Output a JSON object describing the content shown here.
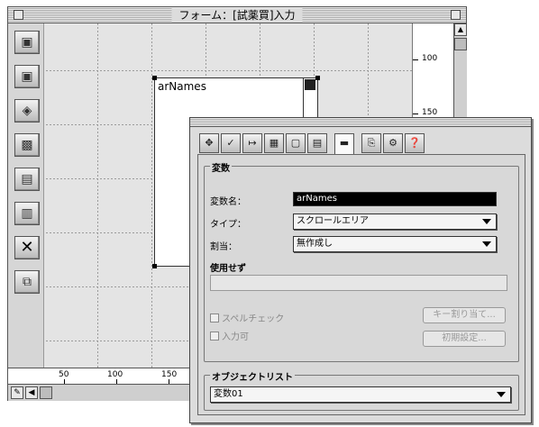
{
  "form_window": {
    "title": "フォーム：[試薬買]入力",
    "list_object_label": "arNames",
    "v_ruler_labels": [
      "100",
      "150"
    ],
    "h_ruler_labels": [
      "50",
      "100",
      "150"
    ],
    "tools": [
      {
        "icon": "field-icon"
      },
      {
        "icon": "field-icon"
      },
      {
        "icon": "button-icon"
      },
      {
        "icon": "database-icon"
      },
      {
        "icon": "document-icon"
      },
      {
        "icon": "document-icon"
      },
      {
        "icon": "delete-x-icon"
      },
      {
        "icon": "copy-icon"
      }
    ]
  },
  "property_window": {
    "tabs": [
      {
        "glyph": "✥",
        "icon": "move-icon"
      },
      {
        "glyph": "✓",
        "icon": "check-icon"
      },
      {
        "glyph": "↦",
        "icon": "arrow-icon"
      },
      {
        "glyph": "▦",
        "icon": "grid-icon"
      },
      {
        "glyph": "▢",
        "icon": "frame-icon"
      },
      {
        "glyph": "▤",
        "icon": "list-icon"
      },
      {
        "glyph": "▬",
        "icon": "field-icon"
      },
      {
        "glyph": "⎘",
        "icon": "copy-icon"
      },
      {
        "glyph": "⚙",
        "icon": "method-icon"
      },
      {
        "glyph": "❓",
        "icon": "help-icon"
      }
    ],
    "variable_group_title": "変数",
    "fields": {
      "var_name_label": "変数名：",
      "var_name_value": "arNames",
      "type_label": "タイプ：",
      "type_value": "スクロールエリア",
      "format_label": "割当：",
      "format_value": "無作成し",
      "unused_label": "使用せず"
    },
    "checkboxes": [
      "スペルチェック",
      "入力可"
    ],
    "buttons": {
      "keys": "キー割り当て...",
      "default": "初期設定..."
    },
    "object_list_title": "オブジェクトリスト",
    "object_list_value": "変数01"
  }
}
